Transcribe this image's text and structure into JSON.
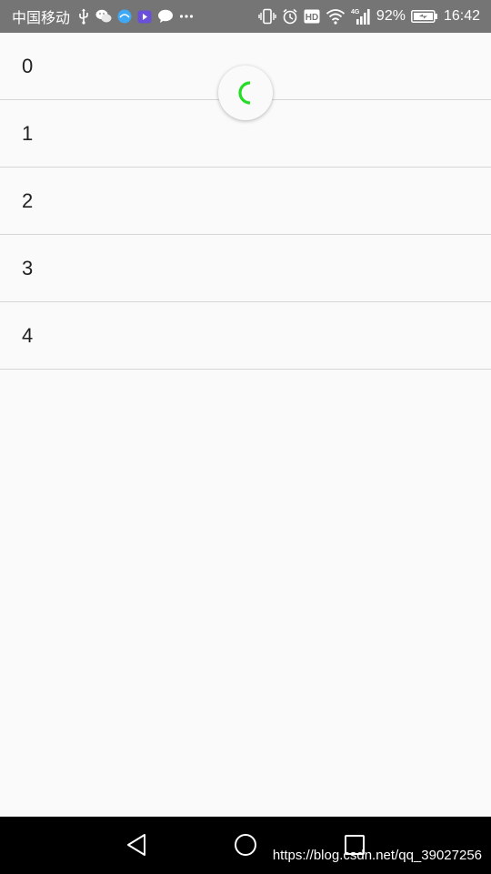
{
  "status_bar": {
    "carrier": "中国移动",
    "network_label": "4G",
    "hd_label": "HD",
    "battery": "92%",
    "time": "16:42",
    "icons": [
      "usb-icon",
      "wechat-icon",
      "app-icon",
      "video-app-icon",
      "message-icon",
      "more-icon",
      "vibrate-icon",
      "alarm-icon",
      "hd-icon",
      "wifi-icon",
      "signal-icon",
      "battery-icon"
    ]
  },
  "list": {
    "items": [
      "0",
      "1",
      "2",
      "3",
      "4"
    ]
  },
  "refresh": {
    "spinner_color": "#22dd22"
  },
  "nav_bar": {
    "icons": [
      "back-icon",
      "home-icon",
      "recents-icon"
    ]
  },
  "watermark": "https://blog.csdn.net/qq_39027256",
  "colors": {
    "status_bar_bg": "#757575",
    "background": "#fafafa",
    "divider": "#d6d6d6",
    "nav_bar_bg": "#000000"
  }
}
